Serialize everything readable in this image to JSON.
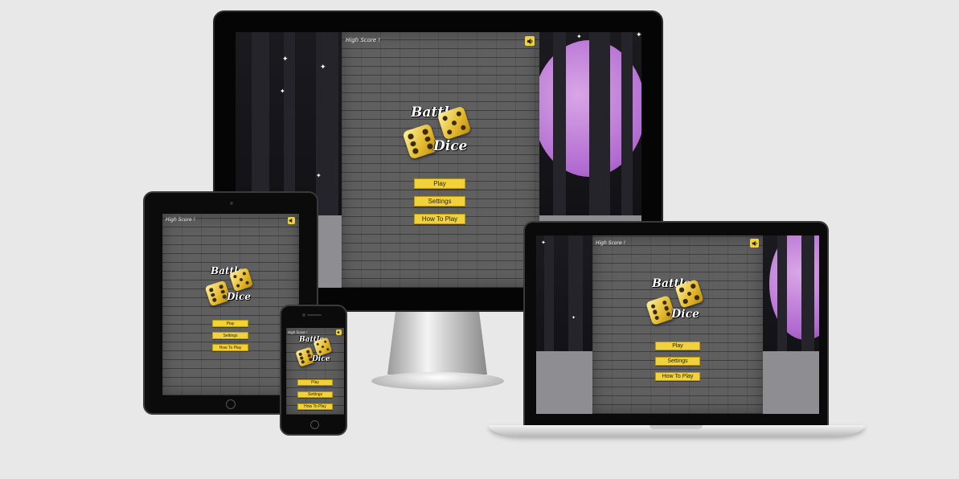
{
  "game": {
    "high_score_label": "High Score !",
    "buttons": {
      "play": "Play",
      "settings": "Settings",
      "how_to_play": "How To Play"
    },
    "logo": {
      "line1": "Battle",
      "line2": "Dice"
    }
  },
  "icons": {
    "sound": "speaker-icon"
  },
  "colors": {
    "button": "#f1d23b",
    "brick": "#5f5f5f",
    "moon": "#b26bd1",
    "page_background": "#e8e8e8"
  }
}
